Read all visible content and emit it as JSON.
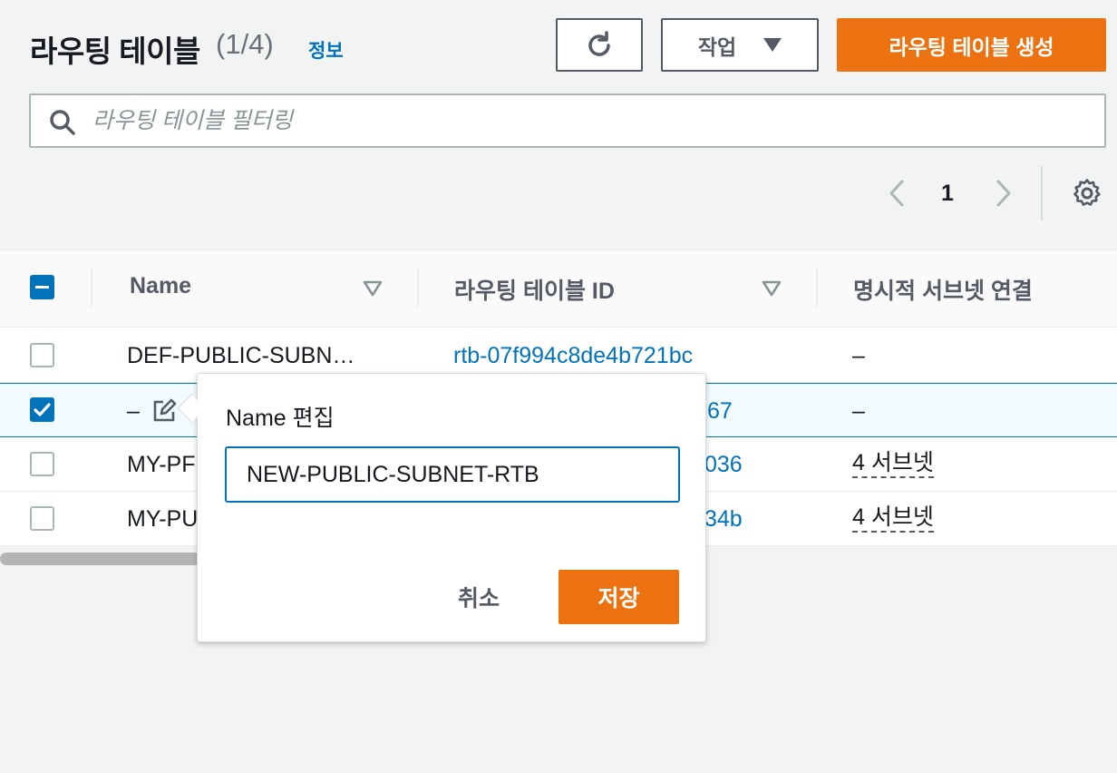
{
  "header": {
    "title": "라우팅 테이블",
    "count": "(1/4)",
    "info_link": "정보",
    "actions_label": "작업",
    "create_label": "라우팅 테이블 생성"
  },
  "search": {
    "placeholder": "라우팅 테이블 필터링"
  },
  "pagination": {
    "current_page": "1"
  },
  "table": {
    "columns": [
      "Name",
      "라우팅 테이블 ID",
      "명시적 서브넷 연결"
    ],
    "rows": [
      {
        "name": "DEF-PUBLIC-SUBN…",
        "id": "rtb-07f994c8de4b721bc",
        "subnets": "–",
        "selected": false
      },
      {
        "name": "–",
        "id": "67",
        "subnets": "–",
        "selected": true
      },
      {
        "name": "MY-PF",
        "id": "036",
        "subnets": "4 서브넷",
        "selected": false
      },
      {
        "name": "MY-PU",
        "id": "34b",
        "subnets": "4 서브넷",
        "selected": false
      }
    ]
  },
  "popover": {
    "title": "Name 편집",
    "input_value": "NEW-PUBLIC-SUBNET-RTB",
    "cancel_label": "취소",
    "save_label": "저장"
  },
  "colors": {
    "accent": "#ec7211",
    "link": "#0073bb"
  }
}
